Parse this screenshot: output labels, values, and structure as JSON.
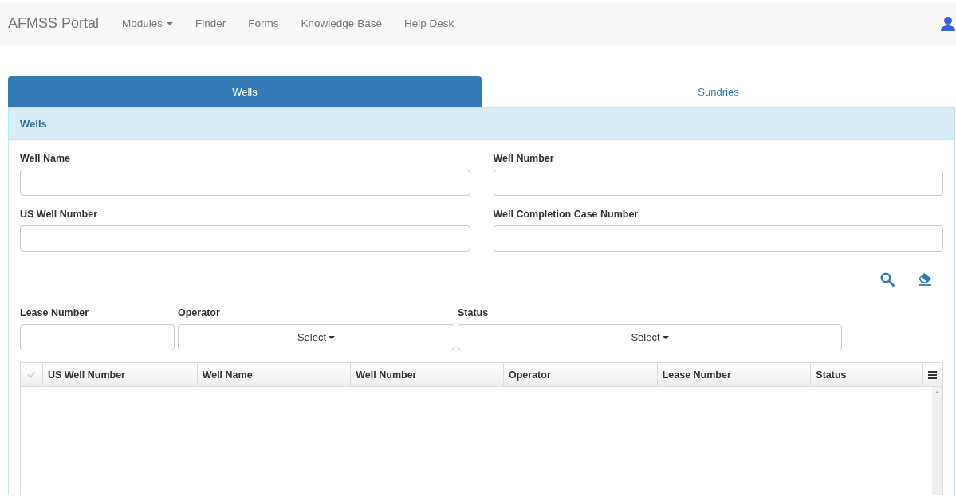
{
  "navbar": {
    "brand": "AFMSS Portal",
    "items": [
      {
        "label": "Modules",
        "dropdown": true
      },
      {
        "label": "Finder",
        "dropdown": false
      },
      {
        "label": "Forms",
        "dropdown": false
      },
      {
        "label": "Knowledge Base",
        "dropdown": false
      },
      {
        "label": "Help Desk",
        "dropdown": false
      }
    ]
  },
  "tabs": [
    {
      "label": "Wells",
      "selected": true
    },
    {
      "label": "Sundries",
      "selected": false
    }
  ],
  "panel": {
    "heading": "Wells",
    "fields": [
      {
        "label": "Well Name"
      },
      {
        "label": "Well Number"
      },
      {
        "label": "US Well Number"
      },
      {
        "label": "Well Completion Case Number"
      }
    ],
    "filters": [
      {
        "label": "Lease Number",
        "kind": "text"
      },
      {
        "label": "Operator",
        "kind": "select",
        "value": "Select"
      },
      {
        "label": "Status",
        "kind": "select",
        "value": "Select"
      }
    ],
    "table": {
      "columns": [
        "US Well Number",
        "Well Name",
        "Well Number",
        "Operator",
        "Lease Number",
        "Status"
      ]
    }
  }
}
